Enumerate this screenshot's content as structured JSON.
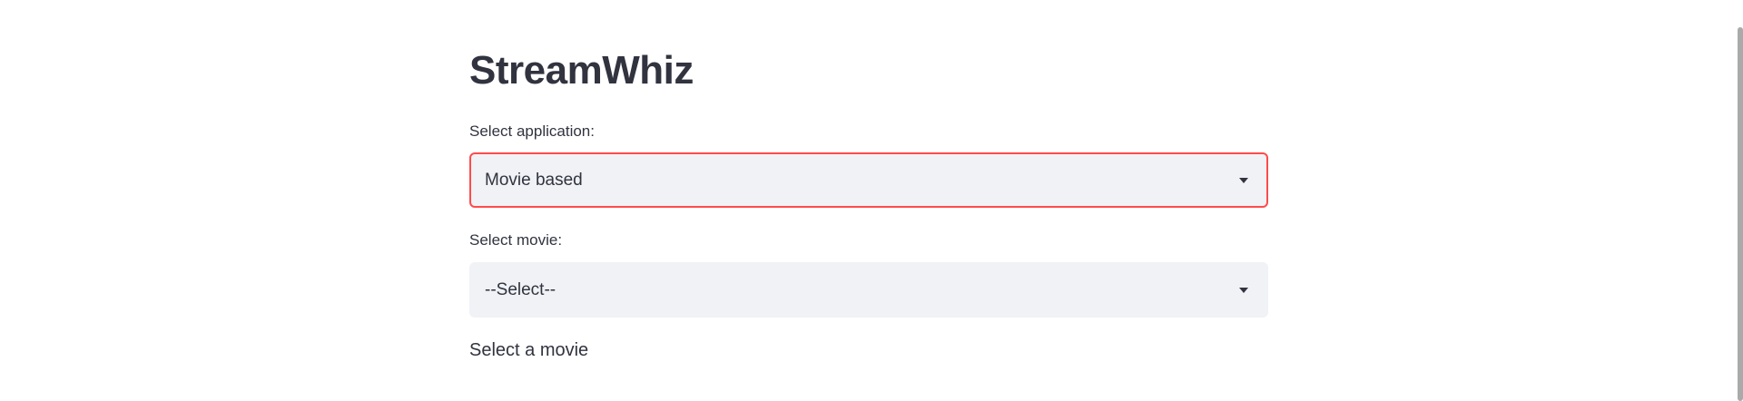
{
  "app": {
    "title": "StreamWhiz"
  },
  "form": {
    "application_select": {
      "label": "Select application:",
      "value": "Movie based",
      "caret_icon": "caret-down-icon"
    },
    "movie_select": {
      "label": "Select movie:",
      "value": "--Select--",
      "caret_icon": "caret-down-icon"
    },
    "hint_text": "Select a movie"
  },
  "colors": {
    "accent_focus_border": "#ff4b4b",
    "select_background": "#f0f2f6",
    "text": "#31333f"
  }
}
